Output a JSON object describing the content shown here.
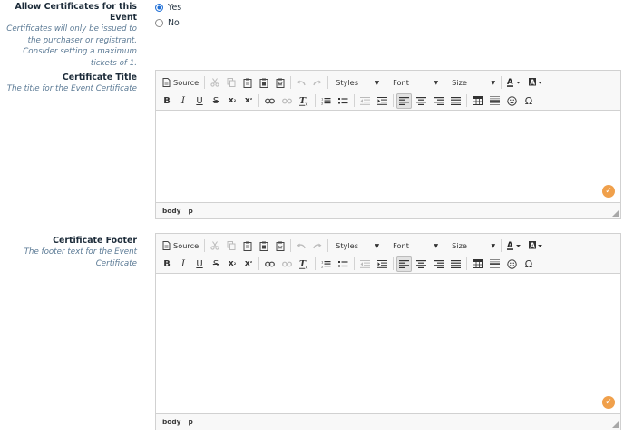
{
  "allow_certificates": {
    "title": "Allow Certificates for this Event",
    "help_lines": [
      "Certificates will only be issued to",
      "the purchaser or registrant.",
      "Consider setting a maximum",
      "tickets of 1."
    ],
    "options": [
      {
        "label": "Yes",
        "checked": true
      },
      {
        "label": "No",
        "checked": false
      }
    ]
  },
  "certificate_title": {
    "title": "Certificate Title",
    "help_lines": [
      "The title for the Event Certificate"
    ]
  },
  "certificate_footer": {
    "title": "Certificate Footer",
    "help_lines": [
      "The footer text for the Event",
      "Certificate"
    ]
  },
  "editor": {
    "source_label": "Source",
    "combos": {
      "styles": "Styles",
      "font": "Font",
      "size": "Size"
    },
    "path": [
      "body",
      "p"
    ],
    "icons": {
      "source": "source-document-icon",
      "cut": "scissors-icon",
      "copy": "copy-icon",
      "paste": "clipboard-icon",
      "paste_text": "clipboard-text-icon",
      "paste_word": "clipboard-word-icon",
      "undo": "undo-arrow-icon",
      "redo": "redo-arrow-icon",
      "link": "link-icon",
      "unlink": "unlink-icon",
      "remove_format": "clear-format-icon",
      "numbered_list": "numbered-list-icon",
      "bullet_list": "bulleted-list-icon",
      "outdent": "outdent-icon",
      "indent": "indent-icon",
      "align_left": "align-left-icon",
      "align_center": "align-center-icon",
      "align_right": "align-right-icon",
      "justify": "justify-icon",
      "table": "table-icon",
      "horizontal_rule": "horizontal-rule-icon",
      "smiley": "smiley-icon",
      "special_char": "omega-icon",
      "text_color": "text-color-icon",
      "bg_color": "background-color-icon",
      "spellcheck": "checkmark-icon"
    },
    "glyphs": {
      "bold": "B",
      "italic": "I",
      "underline": "U",
      "strike": "S",
      "sub_base": "x",
      "sub_mark": "₂",
      "sup_base": "x",
      "sup_mark": "²",
      "omega": "Ω",
      "check": "✓"
    }
  },
  "colors": {
    "accent_blue": "#1f6fd6",
    "help_text": "#5b7a95",
    "spellcheck_orange": "#f0a04b"
  }
}
